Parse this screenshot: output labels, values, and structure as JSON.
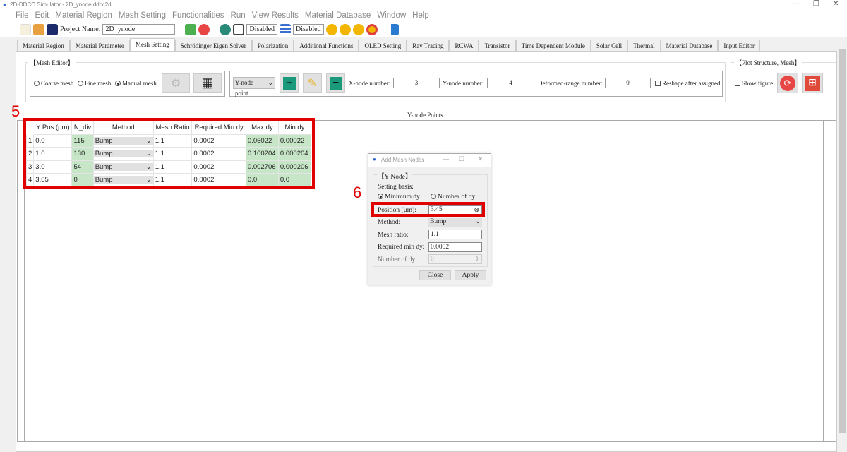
{
  "window": {
    "title": "2D-DDCC Simulator - 2D_ynode.ddcc2d"
  },
  "menu": [
    "File",
    "Edit",
    "Material Region",
    "Mesh Setting",
    "Functionalities",
    "Run",
    "View Results",
    "Material Database",
    "Window",
    "Help"
  ],
  "toolbar": {
    "project_label": "Project Name:",
    "project_name": "2D_ynode",
    "disabled1": "Disabled",
    "disabled2": "Disabled"
  },
  "tabs": [
    "Material Region",
    "Material Parameter",
    "Mesh Setting",
    "Schrödinger Eigen Solver",
    "Polarization",
    "Additional Functions",
    "OLED Setting",
    "Ray Tracing",
    "RCWA",
    "Transistor",
    "Time Dependent Module",
    "Solar Cell",
    "Thermal",
    "Material Database",
    "Input Editor"
  ],
  "active_tab": "Mesh Setting",
  "mesh_editor": {
    "title": "【Mesh Editor】",
    "coarse": "Coarse mesh",
    "fine": "Fine mesh",
    "manual": "Manual mesh",
    "selected": "Manual mesh",
    "node_select": "Y-node point",
    "x_label": "X-node number:",
    "x_value": "3",
    "y_label": "Y-node number:",
    "y_value": "4",
    "deformed_label": "Deformed-range number:",
    "deformed_value": "0",
    "reshape_label": "Reshape after assigned"
  },
  "plot_group": {
    "title": "【Plot Structure, Mesh】",
    "show_figure": "Show figure"
  },
  "ynode": {
    "title": "Y-node Points",
    "headers": [
      "Y Pos (μm)",
      "N_div",
      "Method",
      "Mesh Ratio",
      "Required Min dy",
      "Max dy",
      "Min dy"
    ],
    "rows": [
      {
        "idx": "1",
        "ypos": "0.0",
        "ndiv": "115",
        "method": "Bump",
        "ratio": "1.1",
        "req": "0.0002",
        "max": "0.05022",
        "min": "0.00022"
      },
      {
        "idx": "2",
        "ypos": "1.0",
        "ndiv": "130",
        "method": "Bump",
        "ratio": "1.1",
        "req": "0.0002",
        "max": "0.100204",
        "min": "0.000204"
      },
      {
        "idx": "3",
        "ypos": "3.0",
        "ndiv": "54",
        "method": "Bump",
        "ratio": "1.1",
        "req": "0.0002",
        "max": "0.002706",
        "min": "0.000206"
      },
      {
        "idx": "4",
        "ypos": "3.05",
        "ndiv": "0",
        "method": "Bump",
        "ratio": "1.1",
        "req": "0.0002",
        "max": "0.0",
        "min": "0.0"
      }
    ]
  },
  "annotations": {
    "a5": "5",
    "a6": "6"
  },
  "dialog": {
    "title": "Add Mesh Nodes",
    "section": "【Y Node】",
    "basis_label": "Setting basis:",
    "min_dy": "Minimum dy",
    "num_dy": "Number of dy",
    "position_label": "Position (μm):",
    "position_value": "3.45",
    "method_label": "Method:",
    "method_value": "Bump",
    "ratio_label": "Mesh ratio:",
    "ratio_value": "1.1",
    "req_label": "Required min dy:",
    "req_value": "0.0002",
    "num_label": "Number of dy:",
    "num_value": "0",
    "close": "Close",
    "apply": "Apply"
  }
}
